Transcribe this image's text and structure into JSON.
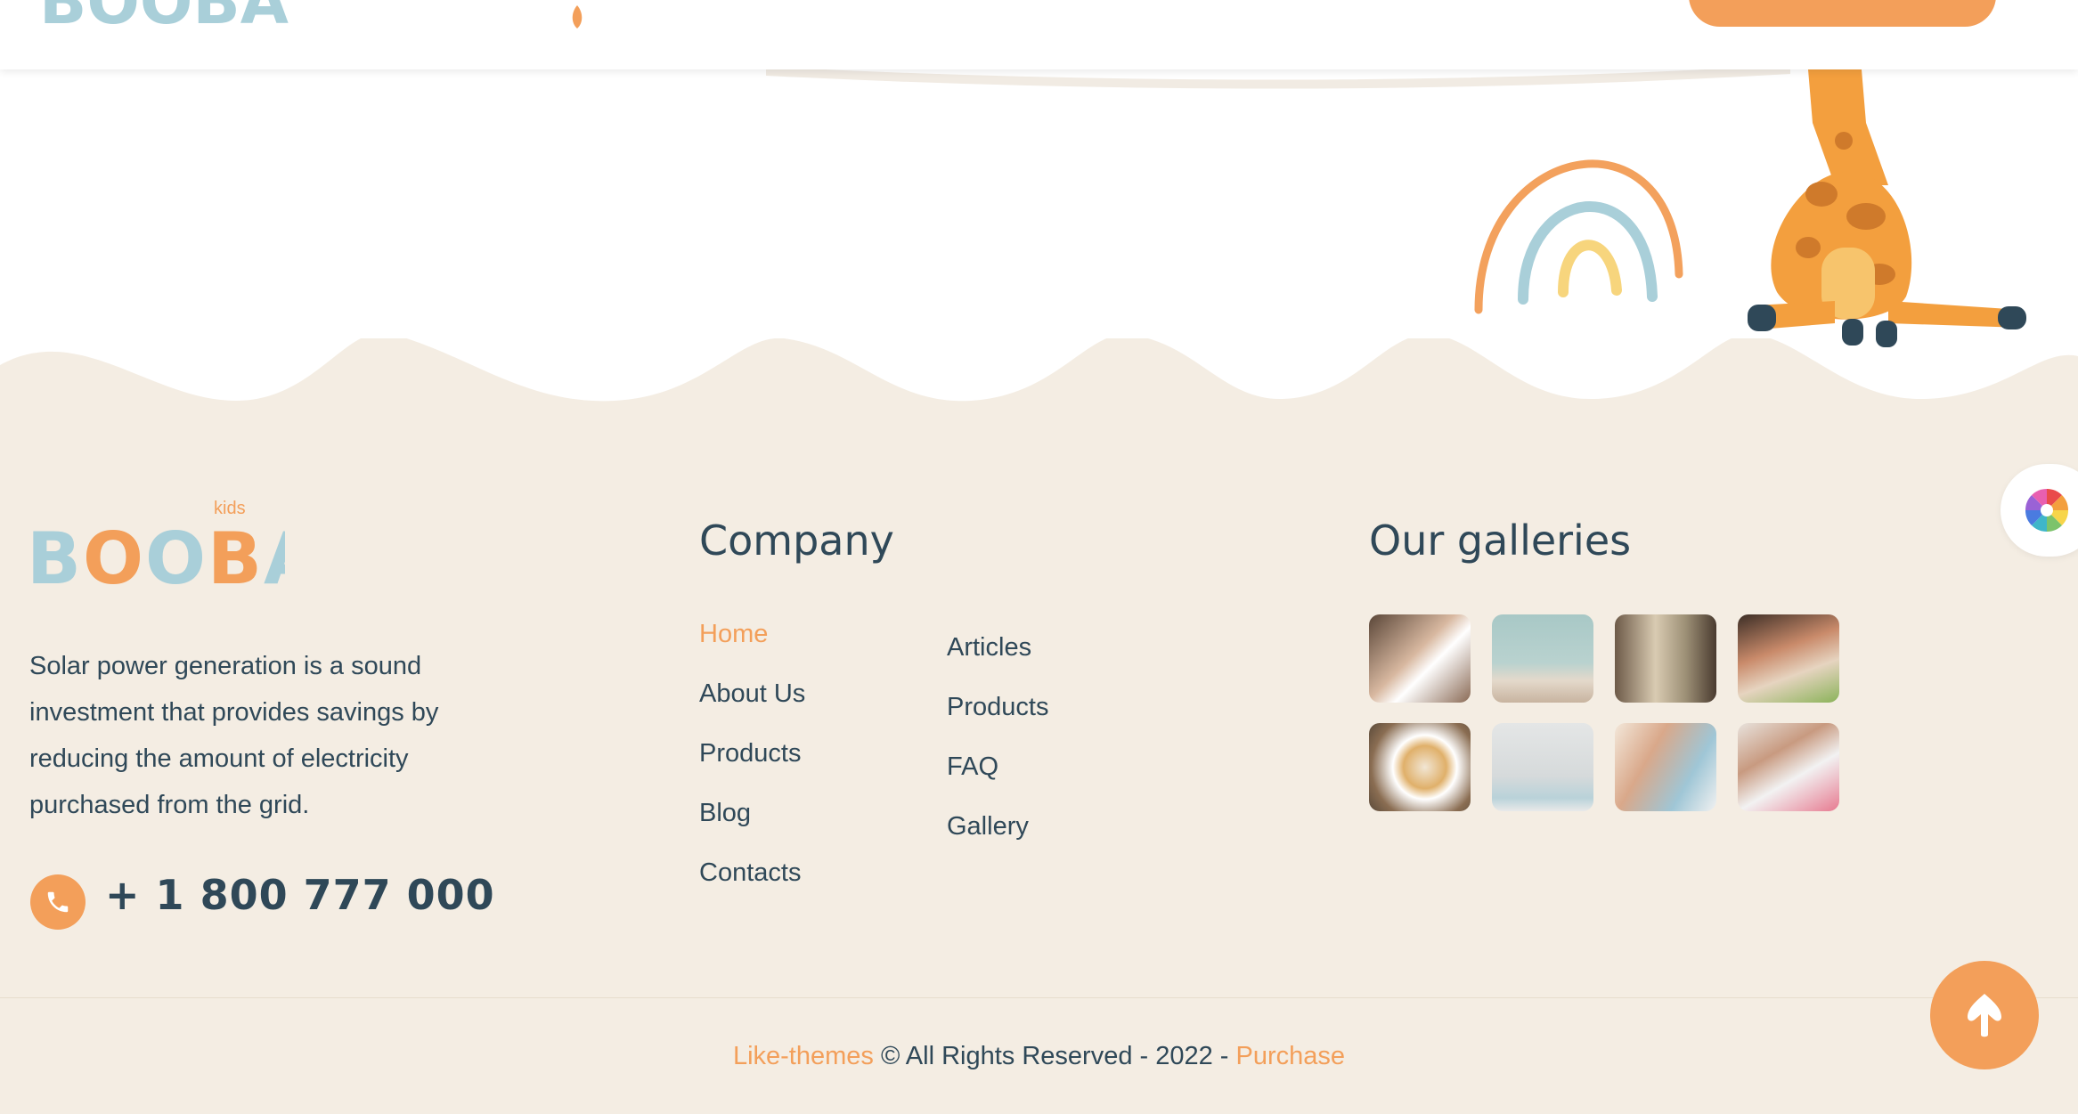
{
  "header": {
    "logo_text": "BOOBA"
  },
  "footer": {
    "logo": {
      "text": "BOOBA",
      "tag": "kids"
    },
    "about_lines": [
      "Solar power generation is a sound",
      "investment that provides savings by",
      "reducing the amount of electricity",
      "purchased from the grid."
    ],
    "phone": "+ 1 800 777 000",
    "company": {
      "title": "Company",
      "col1": [
        "Home",
        "About Us",
        "Products",
        "Blog",
        "Contacts"
      ],
      "col2": [
        "Articles",
        "Products",
        "FAQ",
        "Gallery"
      ],
      "active": "Home"
    },
    "galleries": {
      "title": "Our galleries",
      "items": [
        "kids-reading-photo",
        "nursery-room-photo",
        "toddler-with-toy-photo",
        "kids-playing-photo",
        "pancakes-plate-photo",
        "toy-room-photo",
        "smiling-child-photo",
        "kids-crafting-photo"
      ]
    },
    "copyright": {
      "brand": "Like-themes",
      "middle": "© All Rights Reserved - 2022 -",
      "link": "Purchase"
    }
  },
  "colors": {
    "accent": "#f39f5a",
    "text": "#2f4858",
    "footer_bg": "#f4ede3"
  },
  "icons": {
    "phone": "phone-icon",
    "to_top": "arrow-up-icon",
    "color_switcher": "color-wheel-icon"
  }
}
